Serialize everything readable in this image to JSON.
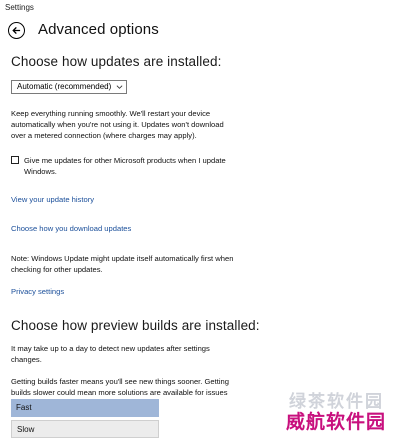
{
  "window": {
    "title": "Settings"
  },
  "header": {
    "back_icon": "back-arrow-icon",
    "title": "Advanced options"
  },
  "updates_section": {
    "heading": "Choose how updates are installed:",
    "select_value": "Automatic (recommended)",
    "description": "Keep everything running smoothly. We'll restart your device\nautomatically when you're not using it. Updates won't download\nover a metered connection (where charges may apply).",
    "checkbox_label": "Give me updates for other Microsoft products when I update\nWindows.",
    "checkbox_checked": false,
    "link_history": "View your update history",
    "link_download": "Choose how you download updates",
    "note": "Note: Windows Update might update itself automatically first when\nchecking for other updates.",
    "link_privacy": "Privacy settings"
  },
  "preview_section": {
    "heading": "Choose how preview builds are installed:",
    "text1": "It may take up to a day to detect new updates after settings\nchanges.",
    "text2": "Getting builds faster means you'll see new things sooner. Getting\nbuilds slower could mean more solutions are available for issues",
    "options": [
      {
        "label": "Fast",
        "selected": true
      },
      {
        "label": "Slow",
        "selected": false
      }
    ]
  },
  "watermark": {
    "line1": "绿茶软件园",
    "line2": "威航软件园"
  },
  "colors": {
    "link": "#1b4f9a",
    "selected_option": "#9fb6d8",
    "watermark": "#c8107e"
  }
}
